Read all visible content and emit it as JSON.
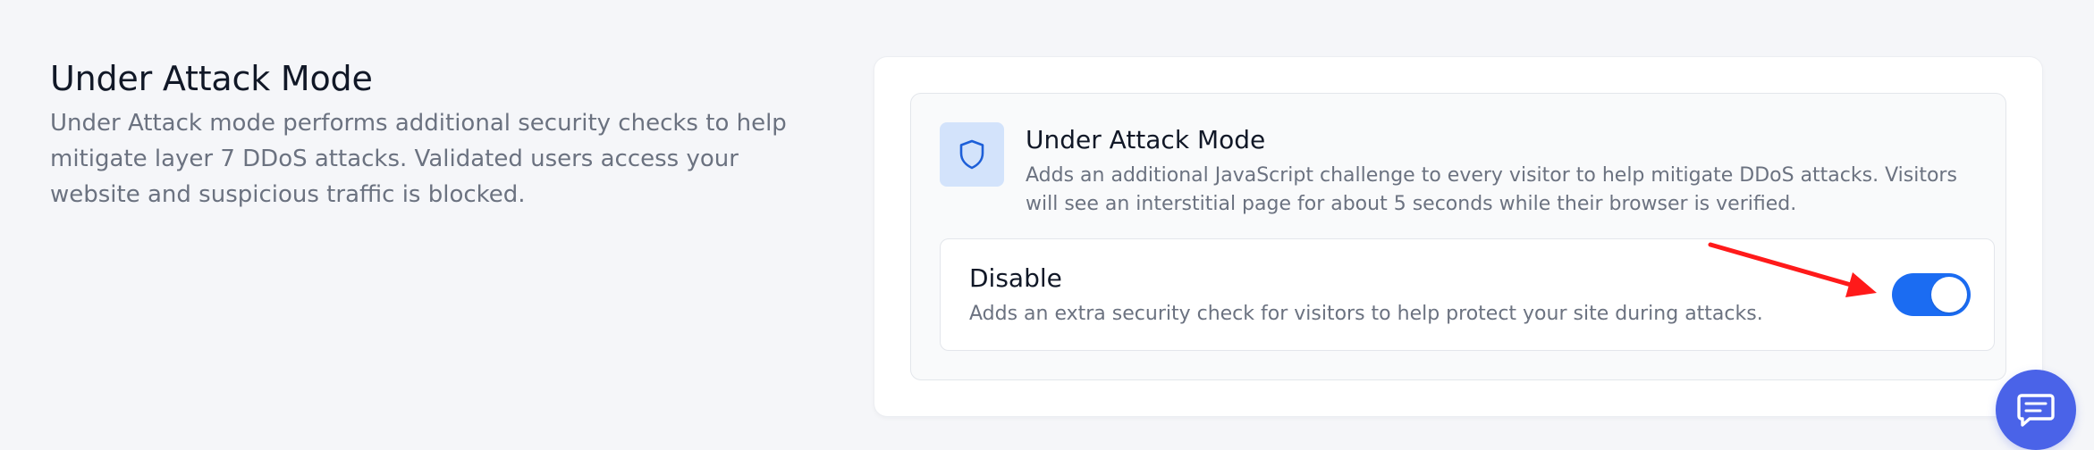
{
  "section": {
    "title": "Under Attack Mode",
    "description": "Under Attack mode performs additional security checks to help mitigate layer 7 DDoS attacks. Validated users access your website and suspicious traffic is blocked."
  },
  "feature": {
    "icon": "shield-icon",
    "title": "Under Attack Mode",
    "description": "Adds an additional JavaScript challenge to every visitor to help mitigate DDoS attacks. Visitors will see an interstitial page for about 5 seconds while their browser is verified."
  },
  "option": {
    "title": "Disable",
    "description": "Adds an extra security check for visitors to help protect your site during attacks.",
    "toggle_on": true
  },
  "annotation": {
    "type": "red-arrow",
    "color": "#ff0000",
    "points_to": "toggle-switch"
  },
  "chat": {
    "icon": "chat-icon"
  },
  "colors": {
    "background": "#f5f6f9",
    "accent": "#1b6cf2",
    "icon_bg": "#d3e3fb",
    "chat": "#4a63e8",
    "text_primary": "#111827",
    "text_secondary": "#6b7280"
  }
}
